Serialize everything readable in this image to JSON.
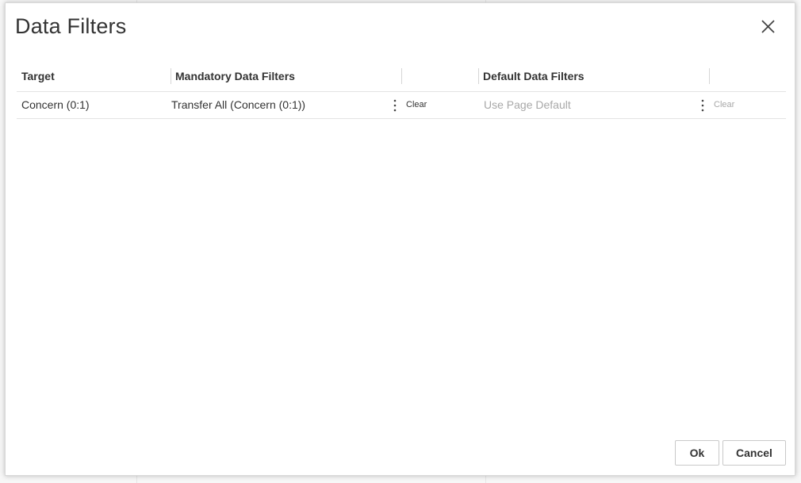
{
  "dialog": {
    "title": "Data Filters",
    "close_icon": "close-icon"
  },
  "table": {
    "columns": [
      "Target",
      "Mandatory Data Filters",
      "",
      "Default Data Filters",
      ""
    ],
    "rows": [
      {
        "target": "Concern (0:1)",
        "mandatory_filter": "Transfer All (Concern (0:1))",
        "mandatory_clear": "Clear",
        "default_filter_placeholder": "Use Page Default",
        "default_clear": "Clear"
      }
    ]
  },
  "buttons": {
    "ok_label": "Ok",
    "cancel_label": "Cancel"
  },
  "icons": {
    "row_menu": "more-vertical-icon"
  }
}
